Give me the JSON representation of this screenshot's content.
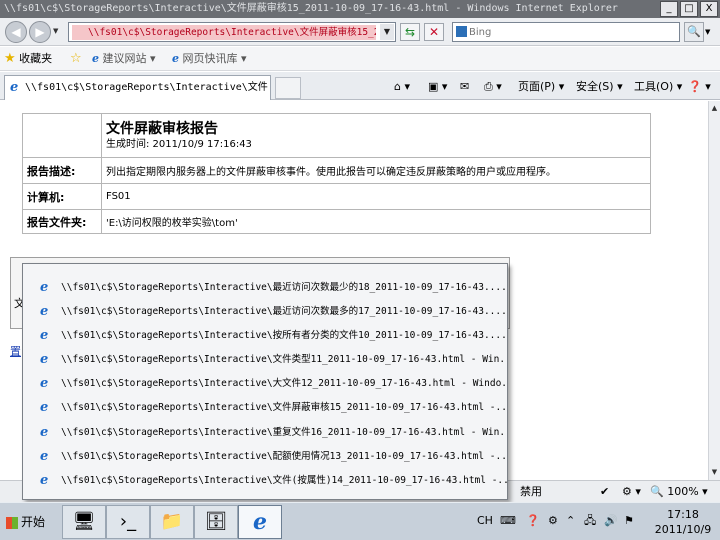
{
  "window": {
    "title": "\\\\fs01\\c$\\StorageReports\\Interactive\\文件屏蔽审核15_2011-10-09_17-16-43.html - Windows Internet Explorer",
    "minimize": "_",
    "maximize": "□",
    "close": "X"
  },
  "address_bar": {
    "url": "\\\\fs01\\c$\\StorageReports\\Interactive\\文件屏蔽审核15_20",
    "search_placeholder": "Bing"
  },
  "favorites_bar": {
    "favorites_label": "收藏夹",
    "suggested_sites": "建议网站",
    "web_slice_gallery": "网页快讯库"
  },
  "tab": {
    "label": "\\\\fs01\\c$\\StorageReports\\Interactive\\文件..."
  },
  "command_bar": {
    "page": "页面(P)",
    "safety": "安全(S)",
    "tools": "工具(O)"
  },
  "report": {
    "title": "文件屏蔽审核报告",
    "generated": "生成时间: 2011/10/9 17:16:43",
    "rows": [
      {
        "label": "报告描述:",
        "value": "列出指定期限内服务器上的文件屏蔽审核事件。使用此报告可以确定违反屏蔽策略的用户或应用程序。"
      },
      {
        "label": "计算机:",
        "value": "FS01"
      },
      {
        "label": "报告文件夹:",
        "value": "'E:\\访问权限的枚举实验\\tom'"
      }
    ]
  },
  "history_popup": {
    "items": [
      "\\\\fs01\\c$\\StorageReports\\Interactive\\最近访问次数最少的18_2011-10-09_17-16-43....",
      "\\\\fs01\\c$\\StorageReports\\Interactive\\最近访问次数最多的17_2011-10-09_17-16-43....",
      "\\\\fs01\\c$\\StorageReports\\Interactive\\按所有者分类的文件10_2011-10-09_17-16-43....",
      "\\\\fs01\\c$\\StorageReports\\Interactive\\文件类型11_2011-10-09_17-16-43.html - Win...",
      "\\\\fs01\\c$\\StorageReports\\Interactive\\大文件12_2011-10-09_17-16-43.html - Windo...",
      "\\\\fs01\\c$\\StorageReports\\Interactive\\文件屏蔽审核15_2011-10-09_17-16-43.html -...",
      "\\\\fs01\\c$\\StorageReports\\Interactive\\重复文件16_2011-10-09_17-16-43.html - Win...",
      "\\\\fs01\\c$\\StorageReports\\Interactive\\配额使用情况13_2011-10-09_17-16-43.html -...",
      "\\\\fs01\\c$\\StorageReports\\Interactive\\文件(按属性)14_2011-10-09_17-16-43.html -..."
    ]
  },
  "partial": {
    "text": "文",
    "link": "置"
  },
  "status_bar": {
    "mode": "禁用",
    "zoom": "100%"
  },
  "taskbar": {
    "start": "开始",
    "lang": "CH",
    "time": "17:18",
    "date": "2011/10/9"
  }
}
